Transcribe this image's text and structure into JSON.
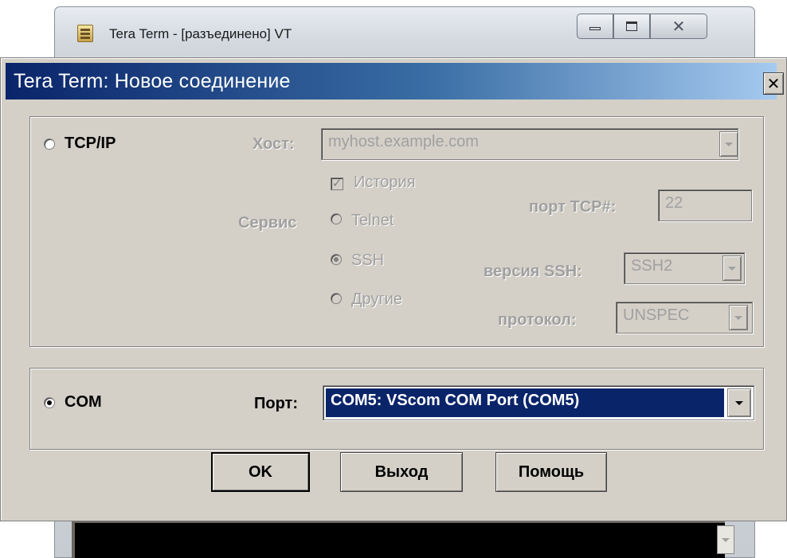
{
  "background_window": {
    "title": "Tera Term - [разъединено] VT",
    "close_glyph": "✕"
  },
  "dialog": {
    "title": "Tera Term: Новое соединение",
    "close_glyph": "✕",
    "tcpip": {
      "radio_label": "TCP/IP",
      "host_label": "Хост:",
      "host_value": "myhost.example.com",
      "history_label": "История",
      "history_checked": true,
      "service_label": "Сервис",
      "services": [
        "Telnet",
        "SSH",
        "Другие"
      ],
      "selected_service": "SSH",
      "tcp_port_label": "порт TCP#:",
      "tcp_port_value": "22",
      "ssh_version_label": "версия SSH:",
      "ssh_version_value": "SSH2",
      "protocol_label": "протокол:",
      "protocol_value": "UNSPEC"
    },
    "com": {
      "radio_label": "COM",
      "port_label": "Порт:",
      "port_value": "COM5: VScom COM Port (COM5)"
    },
    "buttons": {
      "ok": "OK",
      "exit": "Выход",
      "help": "Помощь"
    }
  },
  "connection_type": "COM"
}
